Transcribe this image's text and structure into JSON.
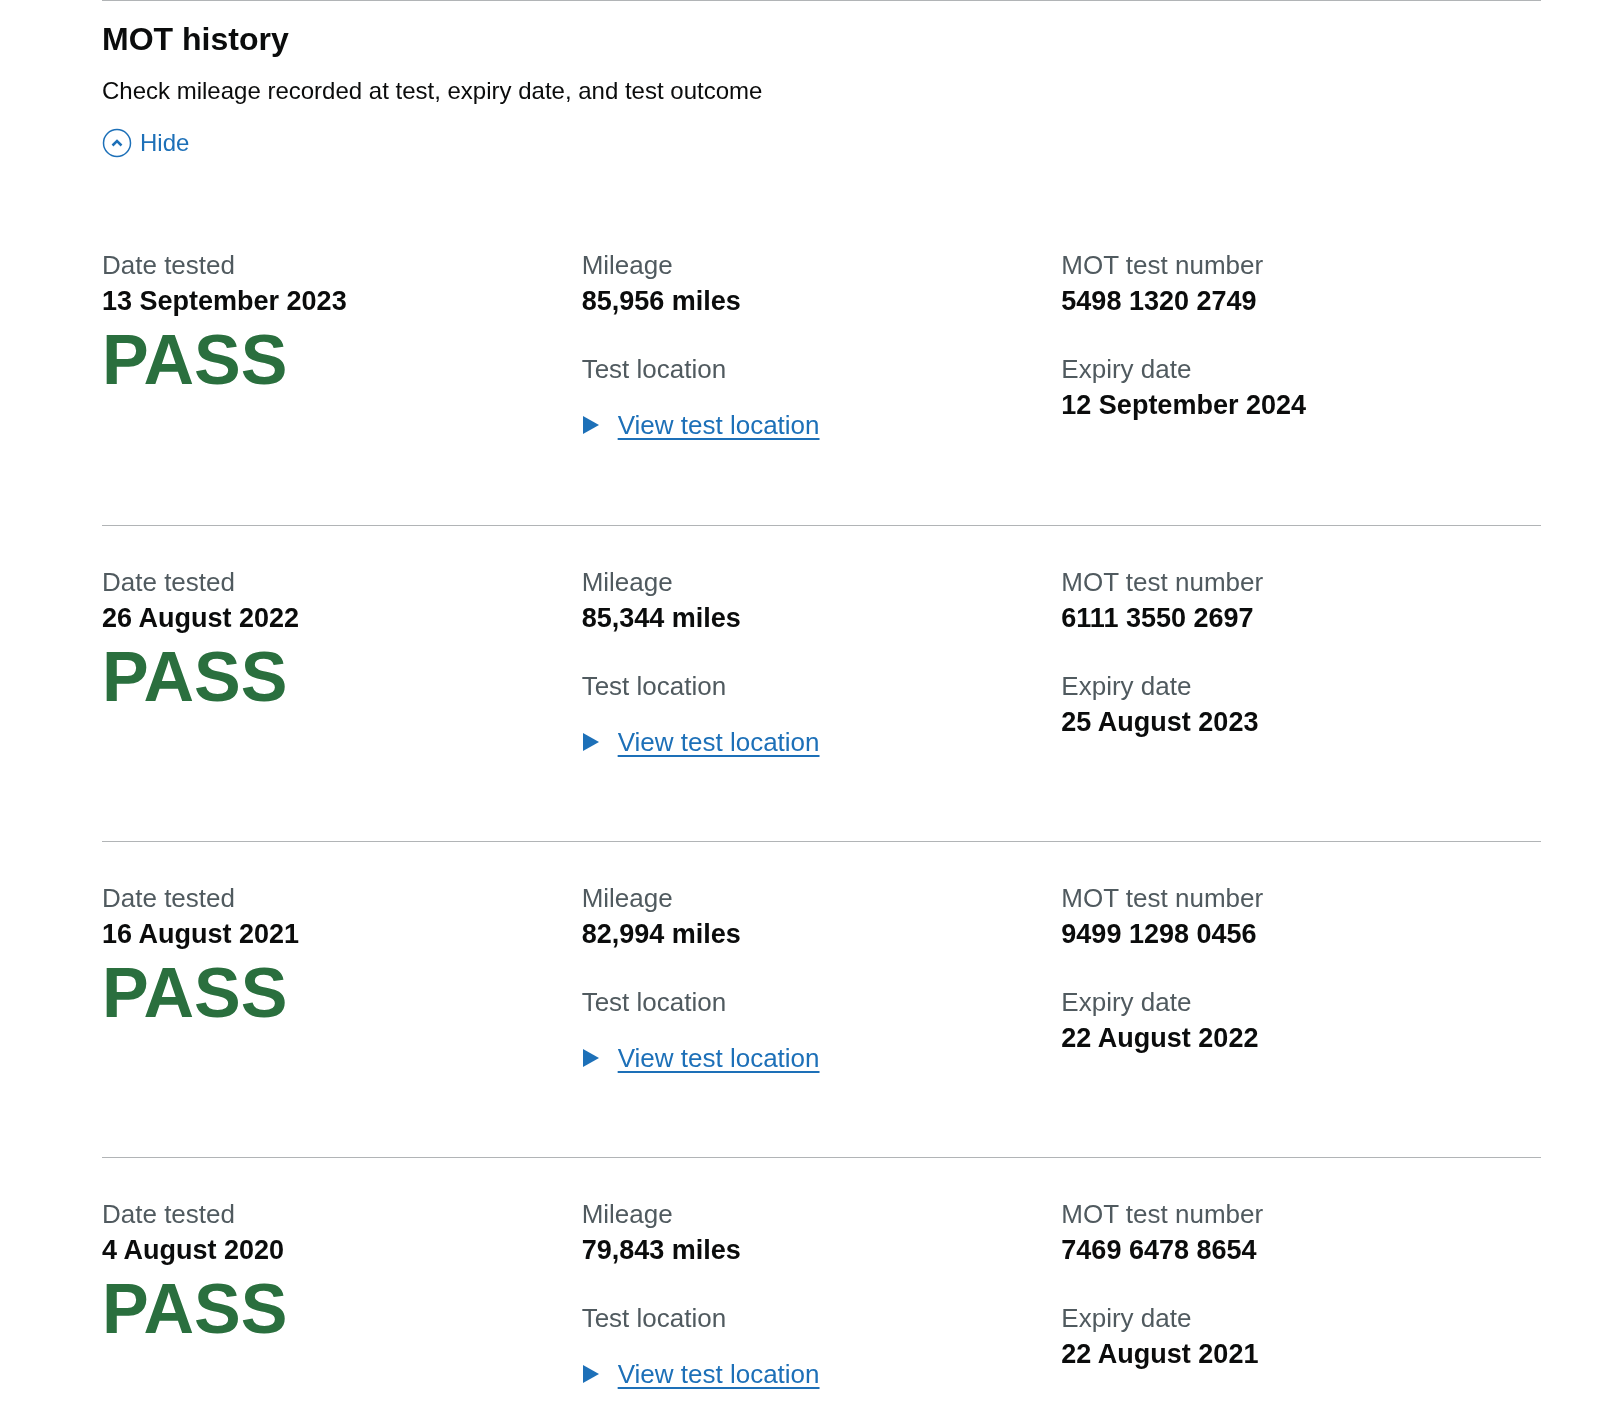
{
  "section": {
    "title": "MOT history",
    "description": "Check mileage recorded at test, expiry date, and test outcome"
  },
  "toggle": {
    "label": "Hide",
    "expanded": true
  },
  "tests": [
    {
      "date_label": "Date tested",
      "date": "13 September 2023",
      "result": "PASS",
      "mileage_label": "Mileage",
      "mileage": "85,956 miles",
      "location_label": "Test location",
      "location_link": "View test location",
      "location_expanded": false,
      "number_label": "MOT test number",
      "number": "5498 1320 2749",
      "expiry_label": "Expiry date",
      "expiry": "12 September 2024"
    },
    {
      "date_label": "Date tested",
      "date": "26 August 2022",
      "result": "PASS",
      "mileage_label": "Mileage",
      "mileage": "85,344 miles",
      "location_label": "Test location",
      "location_link": "View test location",
      "location_expanded": false,
      "number_label": "MOT test number",
      "number": "6111 3550 2697",
      "expiry_label": "Expiry date",
      "expiry": "25 August 2023"
    },
    {
      "date_label": "Date tested",
      "date": "16 August 2021",
      "result": "PASS",
      "mileage_label": "Mileage",
      "mileage": "82,994 miles",
      "location_label": "Test location",
      "location_link": "View test location",
      "location_expanded": false,
      "number_label": "MOT test number",
      "number": "9499 1298 0456",
      "expiry_label": "Expiry date",
      "expiry": "22 August 2022"
    },
    {
      "date_label": "Date tested",
      "date": "4 August 2020",
      "result": "PASS",
      "mileage_label": "Mileage",
      "mileage": "79,843 miles",
      "location_label": "Test location",
      "location_link": "View test location",
      "location_expanded": false,
      "number_label": "MOT test number",
      "number": "7469 6478 8654",
      "expiry_label": "Expiry date",
      "expiry": "22 August 2021"
    }
  ]
}
